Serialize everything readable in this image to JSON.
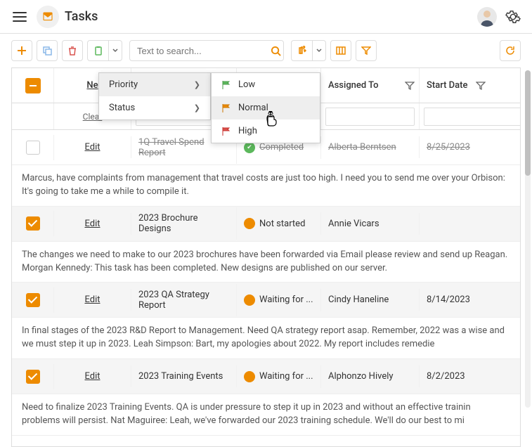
{
  "app": {
    "title": "Tasks"
  },
  "toolbar": {
    "search_placeholder": "Text to search..."
  },
  "grid": {
    "headers": {
      "edit": "Ne",
      "assigned": "Assigned To",
      "date": "Start Date"
    },
    "clear_label": "Clear"
  },
  "context": {
    "priority": "Priority",
    "status": "Status",
    "low": "Low",
    "normal": "Normal",
    "high": "High"
  },
  "rows": [
    {
      "selected": false,
      "edit": "Edit",
      "subject": "1Q Travel Spend Report",
      "status": "Completed",
      "assigned": "Alberta Berntsen",
      "date": "8/25/2023",
      "strike": true,
      "status_color": "green",
      "desc": "Marcus, have complaints from management that travel costs are just too high. I need you to send me over your Orbison: It's going to take me a while to compile it."
    },
    {
      "selected": true,
      "edit": "Edit",
      "subject": "2023 Brochure Designs",
      "status": "Not started",
      "assigned": "Annie Vicars",
      "date": "",
      "strike": false,
      "status_color": "orange",
      "desc": "The changes we need to make to our 2023 brochures have been forwarded via Email please review and send up Reagan. Morgan Kennedy: This task has been completed. New designs are published on our server."
    },
    {
      "selected": true,
      "edit": "Edit",
      "subject": "2023 QA Strategy Report",
      "status": "Waiting for ...",
      "assigned": "Cindy Haneline",
      "date": "8/14/2023",
      "strike": false,
      "status_color": "orange",
      "desc": "In final stages of the 2023 R&D Report to Management. Need QA strategy report asap. Remember, 2022 was a wise and we must step it up in 2023. Leah Simpson: Bart, my apologies about 2022. My report includes remedie"
    },
    {
      "selected": true,
      "edit": "Edit",
      "subject": "2023 Training Events",
      "status": "Waiting for ...",
      "assigned": "Alphonzo Hively",
      "date": "8/2/2023",
      "strike": false,
      "status_color": "orange",
      "desc": "Need to finalize 2023 Training Events. QA is under pressure to step it up in 2023 and without an effective trainin problems will persist. Nat Maguiree: Leah, we've forwarded our 2023 training schedule. We'll do our best to mi"
    }
  ]
}
